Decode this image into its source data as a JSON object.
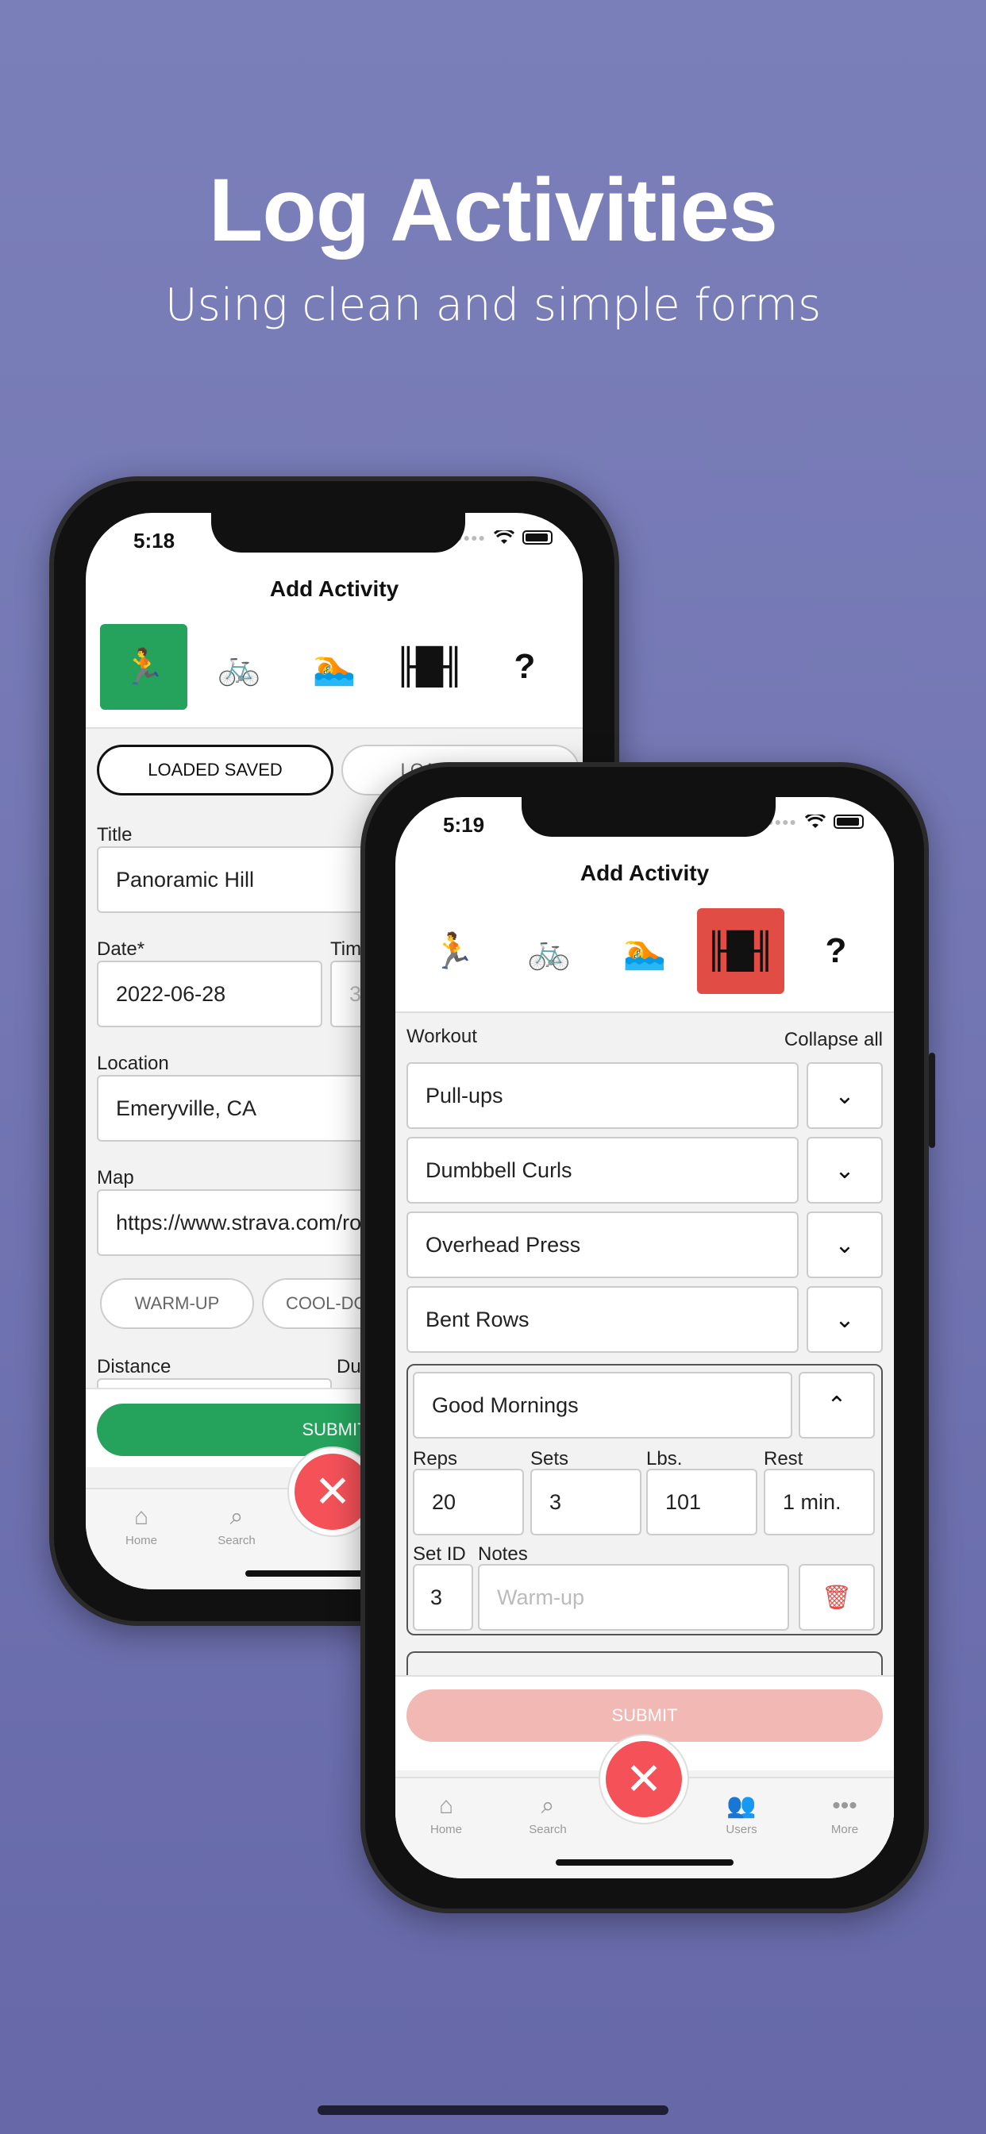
{
  "headline": "Log Activities",
  "subline": "Using clean and simple forms",
  "phone1": {
    "time": "5:18",
    "title": "Add Activity",
    "load_saved": "LOADED SAVED",
    "load_strava": "LOAD STRAVA",
    "title_label": "Title",
    "title_value": "Panoramic Hill",
    "date_label": "Date*",
    "date_value": "2022-06-28",
    "time_label": "Time",
    "time_value": "3",
    "location_label": "Location",
    "location_value": "Emeryville, CA",
    "map_label": "Map",
    "map_value": "https://www.strava.com/routes",
    "warmup": "WARM-UP",
    "cooldown": "COOL-DOWN",
    "distance_label": "Distance",
    "duration_label": "Duration",
    "submit": "SUBMIT",
    "tabs": {
      "home": "Home",
      "search": "Search"
    },
    "type_icons": [
      "running-icon",
      "cycling-icon",
      "swimming-icon",
      "weights-icon",
      "question-icon"
    ],
    "active_color": "#25a35d"
  },
  "phone2": {
    "time": "5:19",
    "title": "Add Activity",
    "workout_label": "Workout",
    "collapse_all": "Collapse all",
    "exercises": [
      "Pull-ups",
      "Dumbbell Curls",
      "Overhead Press",
      "Bent Rows"
    ],
    "expanded": {
      "name": "Good Mornings",
      "reps_label": "Reps",
      "reps": "20",
      "sets_label": "Sets",
      "sets": "3",
      "lbs_label": "Lbs.",
      "lbs": "101",
      "rest_label": "Rest",
      "rest": "1 min.",
      "setid_label": "Set ID",
      "setid": "3",
      "notes_label": "Notes",
      "notes_placeholder": "Warm-up"
    },
    "submit": "SUBMIT",
    "tabs": {
      "home": "Home",
      "search": "Search",
      "users": "Users",
      "more": "More"
    },
    "active_color": "#e14d44",
    "submit_color": "#f2b8b4"
  }
}
